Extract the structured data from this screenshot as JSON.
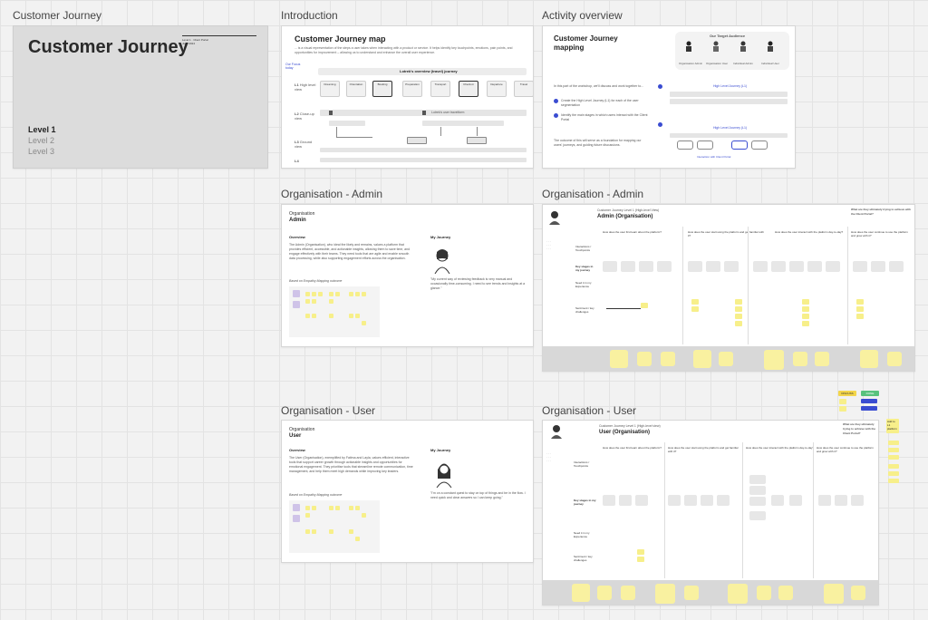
{
  "frames": {
    "customer_journey": {
      "label": "Customer Journey",
      "title": "Customer Journey",
      "meta_left": "Level 1 · Client Portal",
      "meta_right": "June 2024",
      "levels": [
        "Level 1",
        "Level 2",
        "Level 3"
      ]
    },
    "introduction": {
      "label": "Introduction",
      "title": "Customer Journey map",
      "subtitle": "... is a visual representation of the steps a user takes when interacting with a product or service. It helps identify key touchpoints, emotions, pain points, and opportunities for improvement – allowing us to understand and enhance the overall user experience.",
      "focus_tag": "Our Focus today",
      "banner": "Lotrek's overview (travel) journey",
      "rows": [
        {
          "code": "L1",
          "name": "High level view"
        },
        {
          "code": "L2",
          "name": "Close-up view"
        },
        {
          "code": "L3",
          "name": "Ground view"
        },
        {
          "code": "L4",
          "name": ""
        }
      ],
      "steps": [
        "Dreaming",
        "Orientation",
        "Booking",
        "Preparation",
        "Transport",
        "Check-in",
        "Departure",
        "Travel"
      ],
      "subflow": "Lotrek's user travelform"
    },
    "activity": {
      "label": "Activity overview",
      "title": "Customer Journey mapping",
      "audience": "Our Target Audience",
      "personas": [
        "Organisation Admin",
        "Organisation User",
        "Individual Admin",
        "Individual User"
      ],
      "intro": "In this part of the workshop, we'll discuss and work together to...",
      "item1": "Create the High Level Journey (L1) for each of the user segmentation",
      "item2": "Identify the main stages in which users interact with the Client Portal",
      "outro": "The outcome of this will serve as a foundation for mapping our users' journeys, and guiding future discussions.",
      "l1_label": "High Level Journey (L1)",
      "l2_label": "High Level Journey (L1)",
      "portal_label": "Interaction with Client Portal"
    },
    "org_admin": {
      "label": "Organisation - Admin",
      "kicker": "Organisation",
      "title": "Admin",
      "overview_h": "Overview",
      "overview": "The Admin (Organisation), who ideal the likely and remains, values a platform that provides efficient, accessible, and actionable insights, allowing them to save time, and engage effectively with their teams. They need tools that are agile and enable smooth data processing, while also supporting engagement efforts across the organisation.",
      "based_on": "Based on Empathy Mapping outcome",
      "journey_h": "My Journey",
      "journey": "\"My current way of reviewing feedback is very manual and occasionally time-consuming. I need to see trends and insights at a glance.\""
    },
    "org_admin_map": {
      "label": "Organisation - Admin",
      "header": "Customer Journey Level 1 (High-level View)",
      "title": "Admin (Organisation)",
      "question": "What are they ultimately trying to achieve with the Client Portal?",
      "stages": [
        "How does the user first learn about the platform?",
        "How does the user start using the platform and get familiar with it?",
        "How does the user interact with the platform day-to-day?",
        "How does the user continue to use the platform and grow with it?"
      ],
      "rows": [
        "Interactions / Touchpoints",
        "Key stages in my journey",
        "Need it in my Experience",
        "Sentiment / key challenges"
      ]
    },
    "org_user": {
      "label": "Organisation - User",
      "kicker": "Organisation",
      "title": "User",
      "overview_h": "Overview",
      "overview": "The User (Organisation), exemplified by Fatima and Layla, values efficient, interactive tools that support career growth through actionable insights and opportunities for emotional engagement. They prioritise tools that streamline remote communication, time management, and help them meet high demands while improving key leaders.",
      "based_on": "Based on Empathy Mapping outcome",
      "journey_h": "My Journey",
      "journey": "\"I'm on a constant quest to stay on top of things and be in the flow. I need quick and clear answers so I can keep going.\""
    },
    "org_user_map": {
      "label": "Organisation - User",
      "header": "Customer Journey Level 1 (High-level view)",
      "title": "User (Organisation)",
      "question": "What are they ultimately trying to achieve with the Client Portal?",
      "stages": [
        "How does the user first learn about the platform?",
        "How does the user start using the platform and get familiar with it?",
        "How does the user interact with the platform day-to-day?",
        "How does the user continue to use the platform and grow with it?"
      ],
      "legend": [
        "DISCUSS",
        "DONE"
      ],
      "side_note": "Add to L1 platform"
    }
  },
  "colors": {
    "canvas": "#f2f2f2",
    "accent_blue": "#3a4cd1",
    "sticky_yellow": "#f7ef8a",
    "legend_yellow": "#f3d54a",
    "legend_green": "#58c27d"
  }
}
